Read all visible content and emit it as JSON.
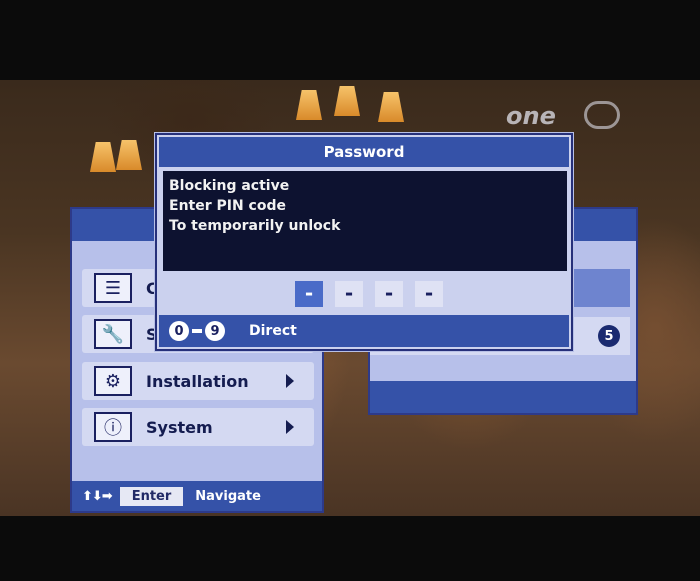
{
  "channel": {
    "logo_text": "one"
  },
  "password_dialog": {
    "title": "Password",
    "message_lines": [
      "Blocking active",
      "Enter PIN code",
      "To temporarily unlock"
    ],
    "pin_digits": [
      "-",
      "-",
      "-",
      "-"
    ],
    "pin_active_index": 0,
    "footer": {
      "key_from": "0",
      "key_to": "9",
      "label": "Direct"
    }
  },
  "main_menu": {
    "items": [
      {
        "label": "C",
        "icon": "list-icon",
        "glyph": "☰"
      },
      {
        "label": "S",
        "icon": "wrench-icon",
        "glyph": "🔧"
      },
      {
        "label": "Installation",
        "icon": "gears-icon",
        "glyph": "⚙"
      },
      {
        "label": "System",
        "icon": "info-icon",
        "glyph": "ⓘ"
      }
    ],
    "footer": {
      "arrows": "⬆⬇➡",
      "enter_label": "Enter",
      "navigate_label": "Navigate"
    }
  },
  "sub_menu": {
    "badge": "5"
  },
  "colors": {
    "accent": "#3552a8",
    "panel": "#b7c0ea",
    "row": "#d4d9f2",
    "message_bg": "#0d1230"
  }
}
